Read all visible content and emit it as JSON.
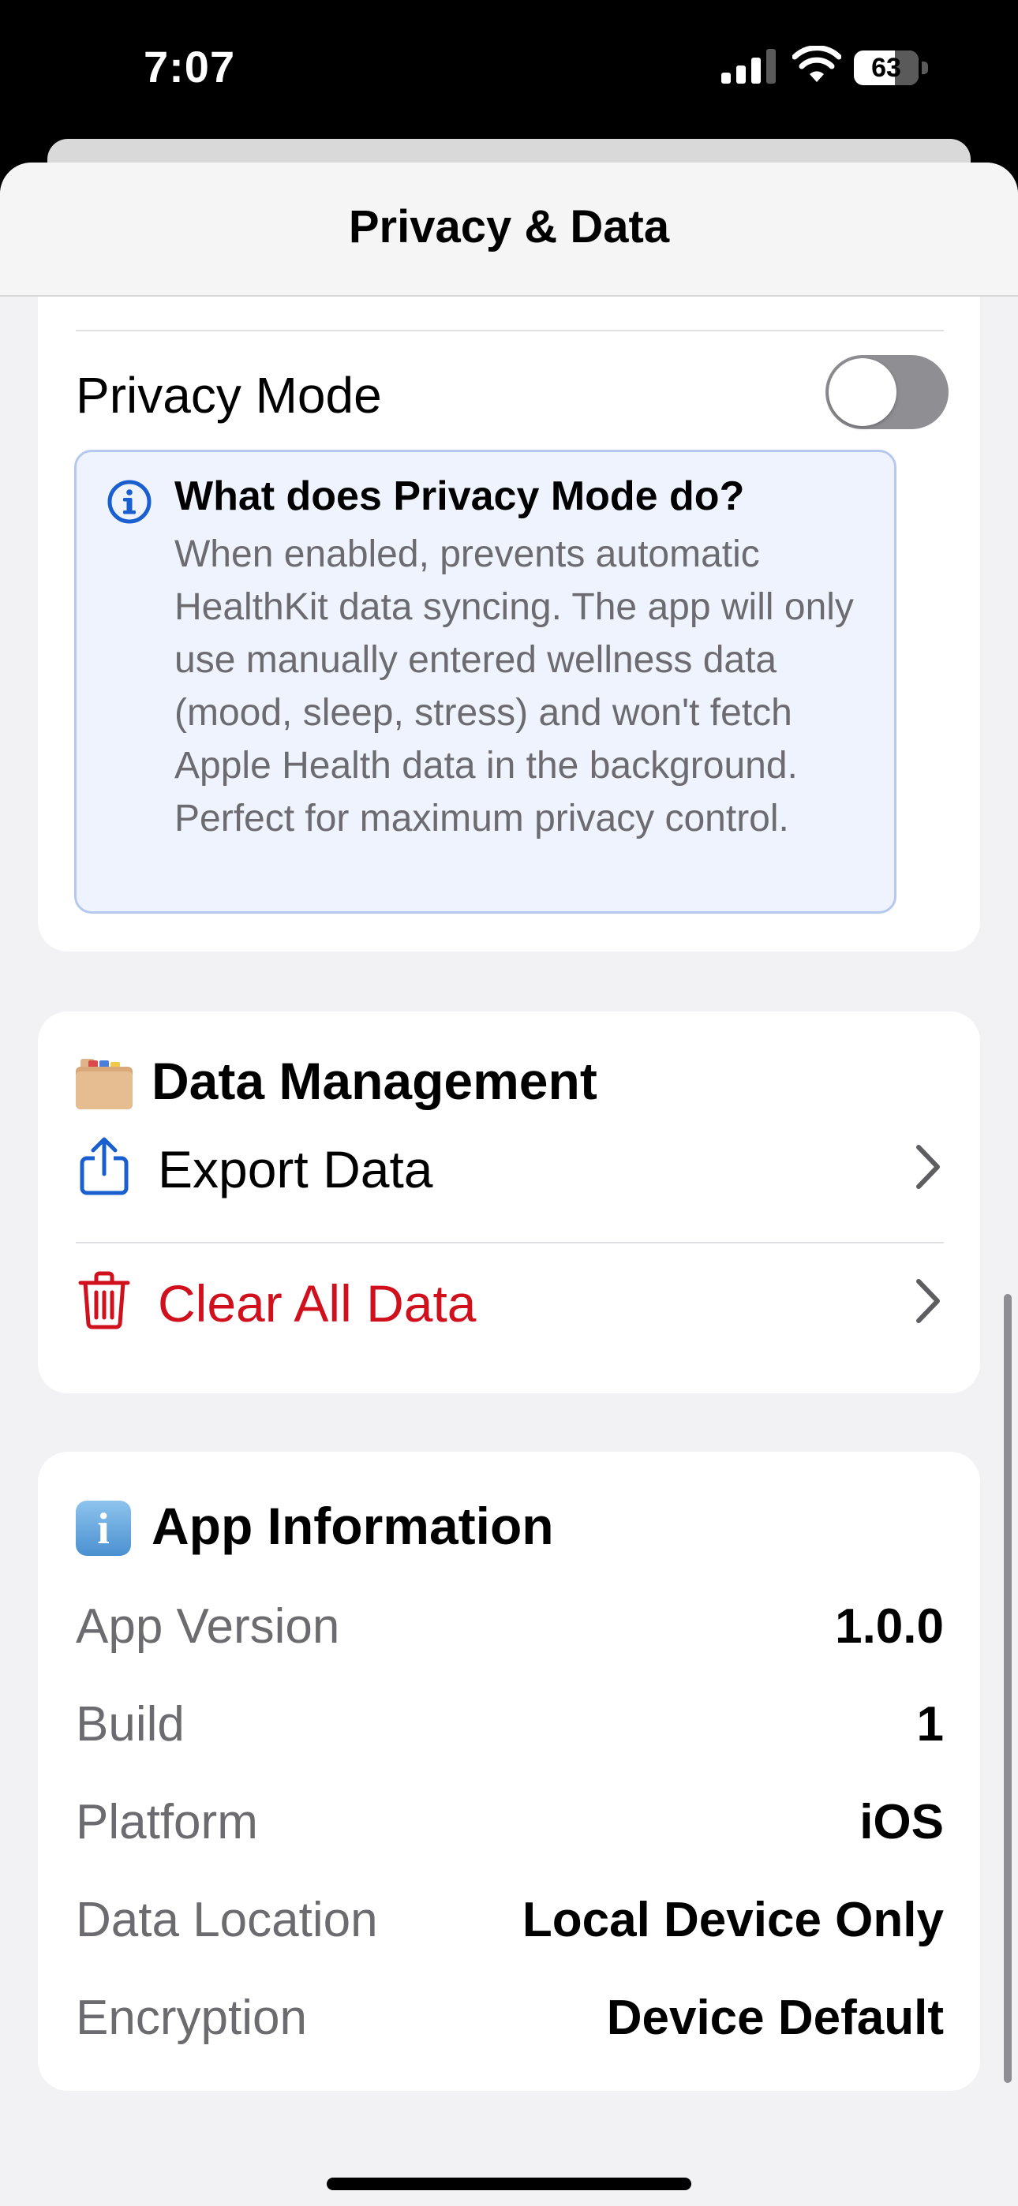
{
  "status_bar": {
    "time": "7:07",
    "battery_level": "63",
    "battery_fraction": 0.63,
    "icons": [
      "signal-icon",
      "wifi-icon",
      "battery-icon"
    ]
  },
  "nav": {
    "title": "Privacy & Data"
  },
  "privacy": {
    "privacy_mode_label": "Privacy Mode",
    "privacy_mode_enabled": false,
    "info_icon": "info-circle-icon",
    "info_title": "What does Privacy Mode do?",
    "info_body": "When enabled, prevents automatic HealthKit data syncing. The app will only use manually entered wellness data (mood, sleep, stress) and won't fetch Apple Health data in the background. Perfect for maximum privacy control."
  },
  "data_management": {
    "icon": "folder-icon",
    "title": "Data Management",
    "export": {
      "label": "Export Data",
      "icon": "share-icon"
    },
    "clear": {
      "label": "Clear All Data",
      "icon": "trash-icon",
      "color": "#d0101c"
    }
  },
  "app_information": {
    "icon": "info-emoji-icon",
    "title": "App Information",
    "rows": [
      {
        "label": "App Version",
        "value": "1.0.0"
      },
      {
        "label": "Build",
        "value": "1"
      },
      {
        "label": "Platform",
        "value": "iOS"
      },
      {
        "label": "Data Location",
        "value": "Local Device Only"
      },
      {
        "label": "Encryption",
        "value": "Device Default"
      }
    ]
  },
  "colors": {
    "accent_blue": "#1a5fd0",
    "destructive_red": "#d0101c",
    "toggle_off": "#8e8e93",
    "info_bg": "#eef3fd"
  }
}
